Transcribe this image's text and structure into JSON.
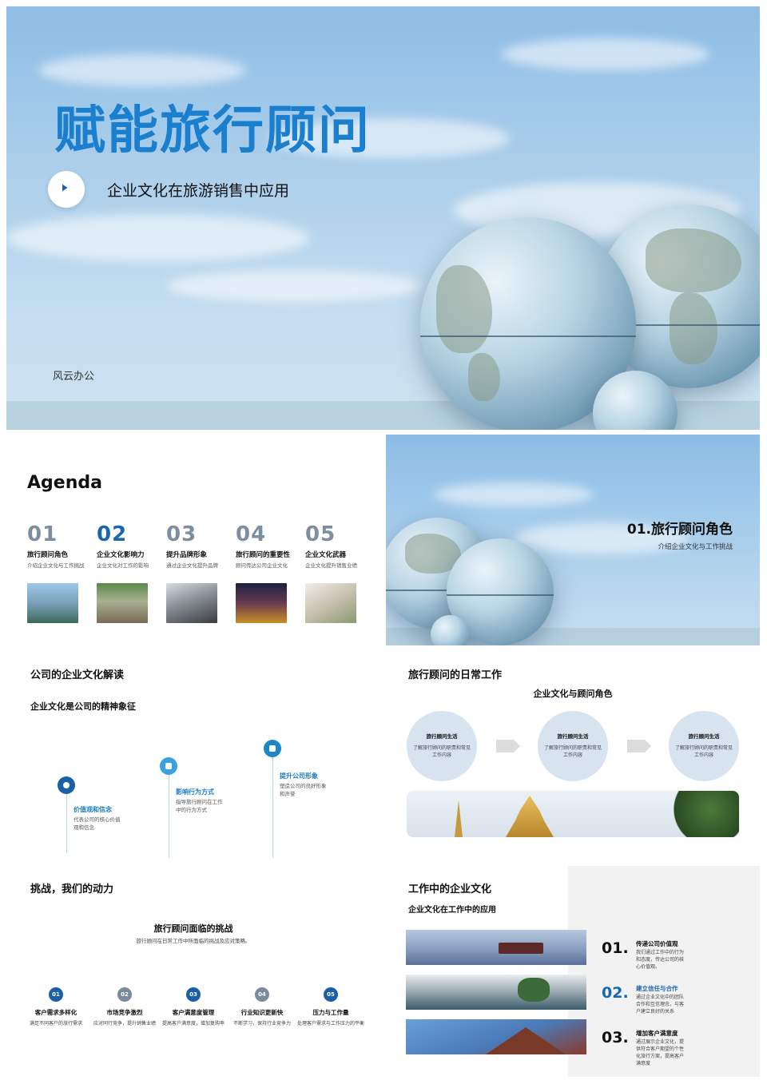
{
  "cover": {
    "title": "赋能旅行顾问",
    "subtitle": "企业文化在旅游销售中应用",
    "brand": "风云办公"
  },
  "agenda": {
    "title": "Agenda",
    "items": [
      {
        "num": "01",
        "title": "旅行顾问角色",
        "desc": "介绍企业文化与工作挑战"
      },
      {
        "num": "02",
        "title": "企业文化影响力",
        "desc": "企业文化对工作的影响"
      },
      {
        "num": "03",
        "title": "提升品牌形象",
        "desc": "通过企业文化提升品牌"
      },
      {
        "num": "04",
        "title": "旅行顾问的重要性",
        "desc": "顾问传达公司企业文化"
      },
      {
        "num": "05",
        "title": "企业文化武器",
        "desc": "企业文化提升销售业绩"
      }
    ]
  },
  "section": {
    "title": "01.旅行顾问角色",
    "subtitle": "介绍企业文化与工作挑战"
  },
  "culture": {
    "title": "公司的企业文化解读",
    "subtitle": "企业文化是公司的精神象征",
    "steps": [
      {
        "title": "价值观和信念",
        "desc": "代表公司的核心价值观和信念"
      },
      {
        "title": "影响行为方式",
        "desc": "指导旅行顾问在工作中的行为方式"
      },
      {
        "title": "提升公司形象",
        "desc": "塑造公司的良好形象和声誉"
      }
    ]
  },
  "daily": {
    "title": "旅行顾问的日常工作",
    "subtitle": "企业文化与顾问角色",
    "circles": [
      {
        "title": "旅行顾问生活",
        "desc": "了解旅行顾问的职责和常见工作内容"
      },
      {
        "title": "旅行顾问生活",
        "desc": "了解旅行顾问的职责和常见工作内容"
      },
      {
        "title": "旅行顾问生活",
        "desc": "了解旅行顾问的职责和常见工作内容"
      }
    ]
  },
  "challenges": {
    "title": "挑战，我们的动力",
    "heading": "旅行顾问面临的挑战",
    "intro": "旅行顾问在日常工作中所面临的挑战及应对策略。",
    "items": [
      {
        "num": "01",
        "title": "客户需求多样化",
        "desc": "满足不同客户的旅行需求"
      },
      {
        "num": "02",
        "title": "市场竞争激烈",
        "desc": "应对同行竞争，提升销售业绩"
      },
      {
        "num": "03",
        "title": "客户满意度管理",
        "desc": "提高客户满意度，增加复购率"
      },
      {
        "num": "04",
        "title": "行业知识更新快",
        "desc": "不断学习，保持行业竞争力"
      },
      {
        "num": "05",
        "title": "压力与工作量",
        "desc": "处理客户需求与工作压力的平衡"
      }
    ],
    "colors": {
      "primary": "#1a5fa8",
      "secondary": "#7b8a9b"
    }
  },
  "work": {
    "title": "工作中的企业文化",
    "subtitle": "企业文化在工作中的应用",
    "items": [
      {
        "num": "01.",
        "title": "传递公司价值观",
        "desc": "我们通过工作中的行为和态度，传达公司的核心价值观。"
      },
      {
        "num": "02.",
        "title": "建立信任与合作",
        "desc": "通过企业文化中的团队合作和互信理念，与客户建立良好的关系"
      },
      {
        "num": "03.",
        "title": "增加客户满意度",
        "desc": "通过展示企业文化，提供符合客户期望的个性化旅行方案，提高客户满意度"
      }
    ]
  },
  "colors": {
    "accent": "#1a7fce",
    "dark_blue": "#1a66b0",
    "light_blue_circle": "#d7e4f0"
  }
}
